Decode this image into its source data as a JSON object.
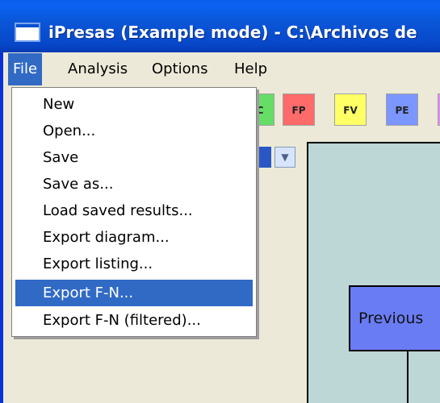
{
  "window": {
    "title": "iPresas (Example mode) - C:\\Archivos de"
  },
  "menubar": {
    "items": [
      "File",
      "Analysis",
      "Options",
      "Help"
    ]
  },
  "file_menu": {
    "items": [
      "New",
      "Open...",
      "Save",
      "Save as...",
      "Load saved results...",
      "Export diagram...",
      "Export listing...",
      "Export F-N...",
      "Export F-N (filtered)..."
    ],
    "highlighted": "Export F-N..."
  },
  "toolbar": {
    "buttons": [
      {
        "label": "C",
        "color": "#66dd66"
      },
      {
        "label": "FP",
        "color": "#ff6a6a"
      },
      {
        "label": "FV",
        "color": "#ffff66"
      },
      {
        "label": "PE",
        "color": "#7b96ff"
      }
    ]
  },
  "diagram": {
    "node_label": "Previous"
  }
}
